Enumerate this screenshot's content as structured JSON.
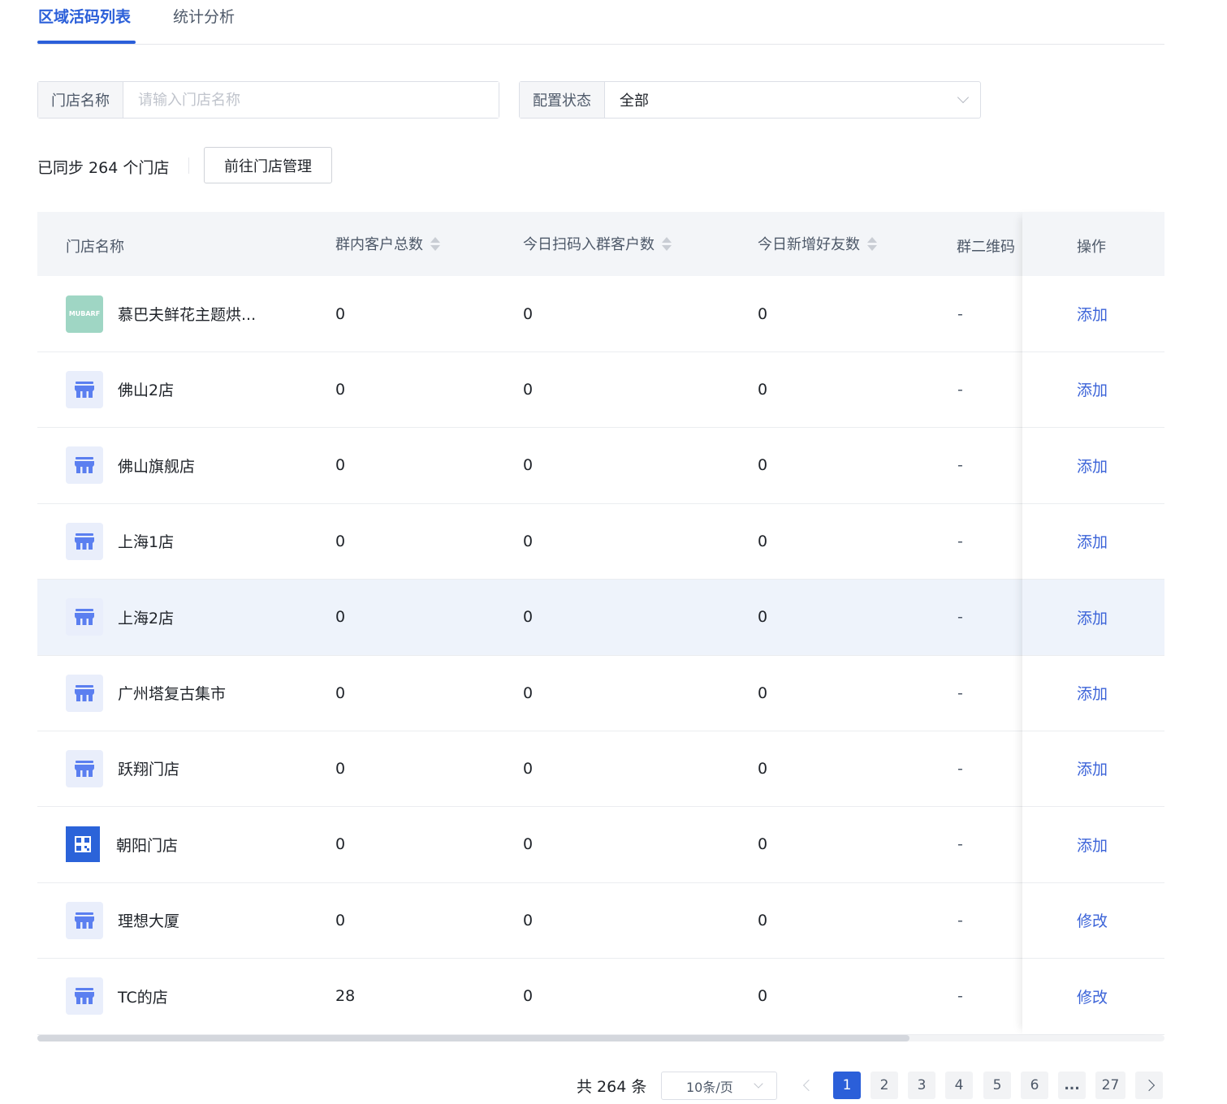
{
  "tabs": [
    {
      "label": "区域活码列表",
      "active": true
    },
    {
      "label": "统计分析",
      "active": false
    }
  ],
  "filters": {
    "store_name_label": "门店名称",
    "store_name_placeholder": "请输入门店名称",
    "status_label": "配置状态",
    "status_value": "全部"
  },
  "sync": {
    "text": "已同步 264 个门店",
    "goto_button": "前往门店管理"
  },
  "table": {
    "columns": [
      "门店名称",
      "群内客户总数",
      "今日扫码入群客户数",
      "今日新增好友数",
      "群二维码",
      "操作"
    ],
    "rows": [
      {
        "name": "慕巴夫鲜花主题烘...",
        "icon": "mubarf-logo",
        "total": "0",
        "scan_today": "0",
        "new_friends": "0",
        "qr": "-",
        "action": "添加"
      },
      {
        "name": "佛山2店",
        "icon": "store-icon",
        "total": "0",
        "scan_today": "0",
        "new_friends": "0",
        "qr": "-",
        "action": "添加"
      },
      {
        "name": "佛山旗舰店",
        "icon": "store-icon",
        "total": "0",
        "scan_today": "0",
        "new_friends": "0",
        "qr": "-",
        "action": "添加"
      },
      {
        "name": "上海1店",
        "icon": "store-icon",
        "total": "0",
        "scan_today": "0",
        "new_friends": "0",
        "qr": "-",
        "action": "添加"
      },
      {
        "name": "上海2店",
        "icon": "store-icon",
        "total": "0",
        "scan_today": "0",
        "new_friends": "0",
        "qr": "-",
        "action": "添加"
      },
      {
        "name": "广州塔复古集市",
        "icon": "store-icon",
        "total": "0",
        "scan_today": "0",
        "new_friends": "0",
        "qr": "-",
        "action": "添加"
      },
      {
        "name": "跃翔门店",
        "icon": "store-icon",
        "total": "0",
        "scan_today": "0",
        "new_friends": "0",
        "qr": "-",
        "action": "添加"
      },
      {
        "name": "朝阳门店",
        "icon": "qr-logo",
        "total": "0",
        "scan_today": "0",
        "new_friends": "0",
        "qr": "-",
        "action": "添加"
      },
      {
        "name": "理想大厦",
        "icon": "store-icon",
        "total": "0",
        "scan_today": "0",
        "new_friends": "0",
        "qr": "-",
        "action": "修改"
      },
      {
        "name": "TC的店",
        "icon": "store-icon",
        "total": "28",
        "scan_today": "0",
        "new_friends": "0",
        "qr": "-",
        "action": "修改"
      }
    ],
    "highlighted_row": 4
  },
  "pagination": {
    "total": "共 264 条",
    "page_size": "10条/页",
    "pages": [
      "1",
      "2",
      "3",
      "4",
      "5",
      "6",
      "...",
      "27"
    ],
    "current": "1"
  },
  "colors": {
    "accent": "#2b5fd9",
    "link": "#3b63d8",
    "header_bg": "#f3f5f8",
    "highlight_row": "#eef3fb"
  }
}
